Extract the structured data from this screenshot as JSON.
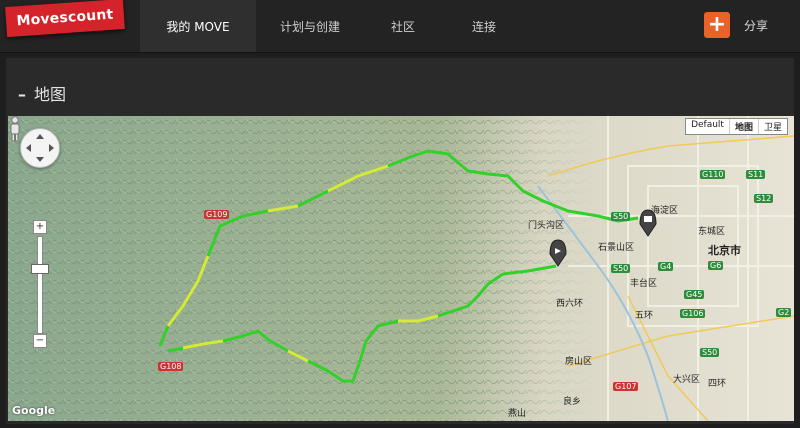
{
  "header": {
    "logo_text": "Movescount",
    "nav": [
      {
        "label": "我的 MOVE",
        "active": true
      },
      {
        "label": "计划与创建",
        "active": false
      },
      {
        "label": "社区",
        "active": false
      },
      {
        "label": "连接",
        "active": false
      }
    ],
    "share_label": "分享",
    "plus_symbol": "+"
  },
  "section": {
    "dash": "–",
    "title": "地图"
  },
  "map": {
    "map_types": [
      {
        "label": "Default",
        "selected": false
      },
      {
        "label": "地图",
        "selected": true
      },
      {
        "label": "卫星",
        "selected": false
      }
    ],
    "zoom_in": "+",
    "zoom_out": "−",
    "attribution": "Google",
    "places": [
      "海淀区",
      "东城区",
      "北京市",
      "门头沟区",
      "石景山区",
      "丰台区",
      "房山区",
      "大兴区",
      "西六环",
      "良乡",
      "五环",
      "四环",
      "燕山"
    ],
    "roads": [
      "G109",
      "G108",
      "G6",
      "G4",
      "G45",
      "G106",
      "G110",
      "S11",
      "S12",
      "S50",
      "G2",
      "G107",
      "S50",
      "S50"
    ],
    "colors": {
      "route_green": "#32d12a",
      "route_yellow": "#d8e83a",
      "marker": "#444444",
      "nav_active": "#2f2f2f",
      "logo": "#d4232a",
      "share_button": "#e8622a"
    }
  }
}
